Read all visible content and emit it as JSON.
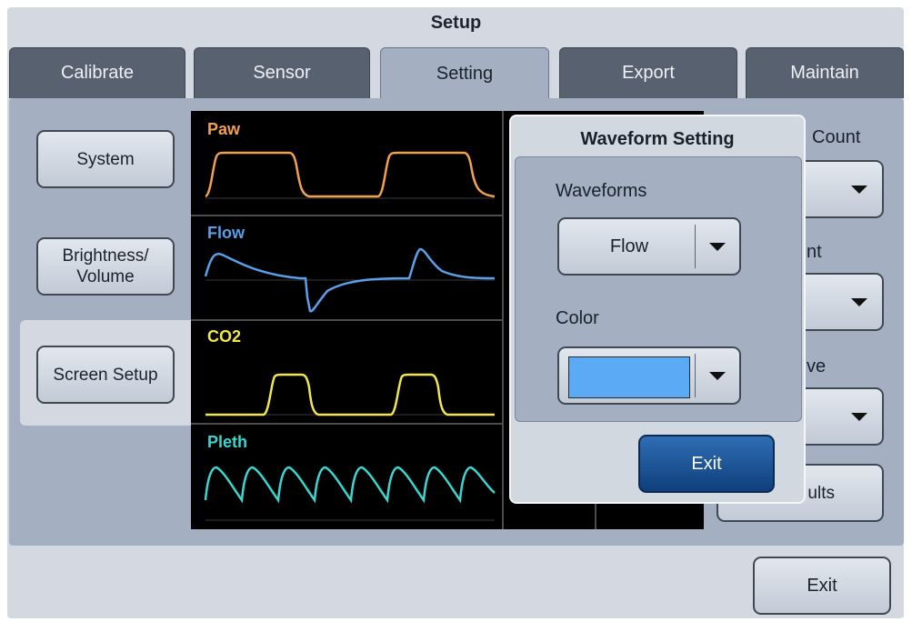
{
  "window": {
    "title": "Setup"
  },
  "tabs": [
    {
      "label": "Calibrate",
      "active": false
    },
    {
      "label": "Sensor",
      "active": false
    },
    {
      "label": "Setting",
      "active": true
    },
    {
      "label": "Export",
      "active": false
    },
    {
      "label": "Maintain",
      "active": false
    }
  ],
  "sidebar": {
    "items": [
      {
        "label": "System"
      },
      {
        "label": "Brightness/\nVolume"
      },
      {
        "label": "Screen Setup",
        "selected": true
      }
    ]
  },
  "waveforms": [
    {
      "label": "Paw",
      "color": "#f0a050"
    },
    {
      "label": "Flow",
      "color": "#5aa0e8"
    },
    {
      "label": "CO2",
      "color": "#f2e64a"
    },
    {
      "label": "Pleth",
      "color": "#3ad6d0"
    }
  ],
  "right_panel": {
    "labels": [
      "Count",
      "nt",
      "ve"
    ],
    "defaults_partial": "ults"
  },
  "dialog": {
    "title": "Waveform Setting",
    "waveforms_label": "Waveforms",
    "waveforms_value": "Flow",
    "color_label": "Color",
    "color_value_hex": "#5aaaf5",
    "exit_label": "Exit"
  },
  "footer": {
    "exit_label": "Exit"
  },
  "icons": {
    "dropdown": "triangle-down-icon"
  }
}
